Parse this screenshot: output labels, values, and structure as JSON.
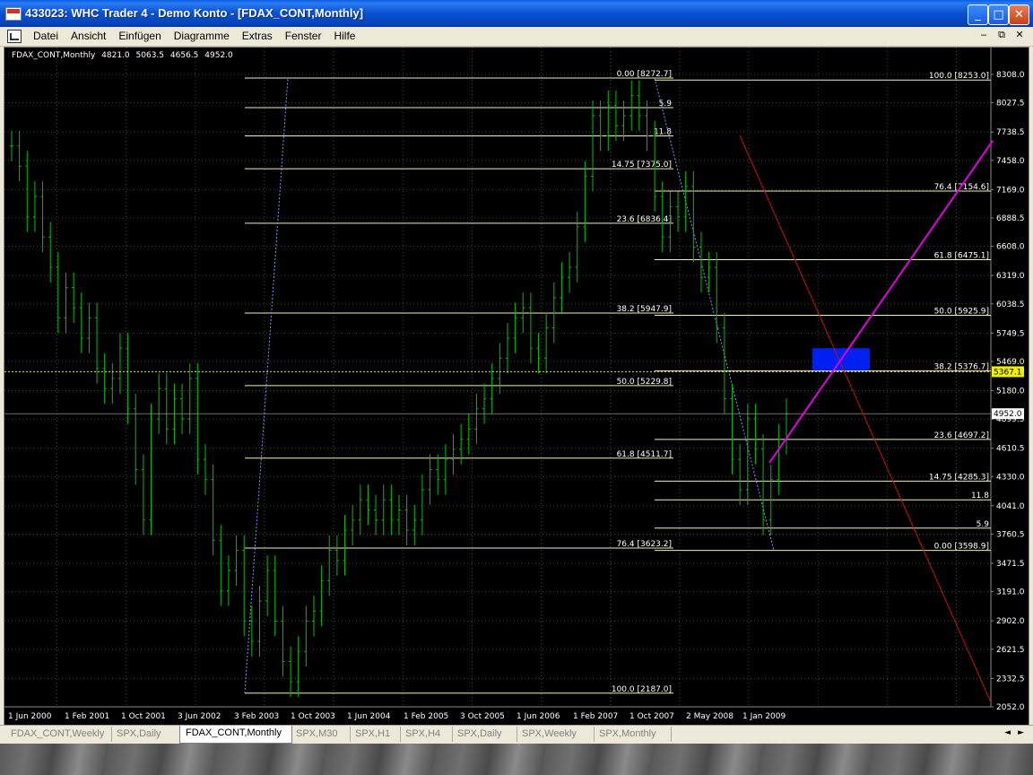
{
  "window": {
    "title": "433023: WHC Trader 4 - Demo Konto - [FDAX_CONT,Monthly]",
    "minimize_label": "_",
    "maximize_label": "□",
    "close_label": "✕"
  },
  "menu": {
    "items": [
      "Datei",
      "Ansicht",
      "Einfügen",
      "Diagramme",
      "Extras",
      "Fenster",
      "Hilfe"
    ],
    "mdi_minimize": "–",
    "mdi_restore": "⧉",
    "mdi_close": "✕"
  },
  "chart": {
    "symbol_period": "FDAX_CONT,Monthly",
    "ohlc": [
      "4821.0",
      "5063.5",
      "4656.5",
      "4952.0"
    ],
    "current_price_label": "4952.0",
    "yellow_level_label": "5367.1"
  },
  "chart_data": {
    "type": "bar",
    "y_axis_labels": [
      "8308.0",
      "8027.5",
      "7738.5",
      "7458.0",
      "7169.0",
      "6888.5",
      "6608.0",
      "6319.0",
      "6038.5",
      "5749.5",
      "5469.0",
      "5180.0",
      "4899.5",
      "4610.5",
      "4330.0",
      "4041.0",
      "3760.5",
      "3471.5",
      "3191.0",
      "2902.0",
      "2621.5",
      "2332.5",
      "2052.0"
    ],
    "x_axis_labels": [
      "1 Jun 2000",
      "1 Feb 2001",
      "1 Oct 2001",
      "3 Jun 2002",
      "3 Feb 2003",
      "1 Oct 2003",
      "1 Jun 2004",
      "1 Feb 2005",
      "3 Oct 2005",
      "1 Jun 2006",
      "1 Feb 2007",
      "1 Oct 2007",
      "2 May 2008",
      "1 Jan 2009"
    ],
    "ylim": [
      2052.0,
      8308.0
    ],
    "fib_set_1": [
      {
        "level": "0.00",
        "value": "8272.7"
      },
      {
        "level": "5.9",
        "value": ""
      },
      {
        "level": "11.8",
        "value": ""
      },
      {
        "level": "14.75",
        "value": "7375.0"
      },
      {
        "level": "23.6",
        "value": "6836.4"
      },
      {
        "level": "38.2",
        "value": "5947.9"
      },
      {
        "level": "50.0",
        "value": "5229.8"
      },
      {
        "level": "61.8",
        "value": "4511.7"
      },
      {
        "level": "76.4",
        "value": "3623.2"
      },
      {
        "level": "100.0",
        "value": "2187.0"
      }
    ],
    "fib_set_2": [
      {
        "level": "100.0",
        "value": "8253.0"
      },
      {
        "level": "76.4",
        "value": "7154.6"
      },
      {
        "level": "61.8",
        "value": "6475.1"
      },
      {
        "level": "50.0",
        "value": "5925.9"
      },
      {
        "level": "38.2",
        "value": "5376.7"
      },
      {
        "level": "23.6",
        "value": "4697.2"
      },
      {
        "level": "14.75",
        "value": "4285.3"
      },
      {
        "level": "11.8",
        "value": ""
      },
      {
        "level": "5.9",
        "value": ""
      },
      {
        "level": "0.00",
        "value": "3598.9"
      }
    ],
    "price_path": [
      7600,
      7400,
      6900,
      7100,
      6700,
      6400,
      5900,
      6200,
      6000,
      5700,
      5900,
      5400,
      5200,
      5300,
      5600,
      5000,
      4400,
      3900,
      4900,
      5200,
      4800,
      5100,
      4900,
      5300,
      4500,
      4300,
      3700,
      3200,
      3400,
      3600,
      2900,
      2700,
      3100,
      3400,
      2900,
      2500,
      2300,
      2600,
      2900,
      3000,
      3300,
      3600,
      3500,
      3800,
      3900,
      4100,
      4000,
      3900,
      4100,
      3900,
      4000,
      3800,
      3900,
      4200,
      4400,
      4300,
      4500,
      4600,
      4700,
      4800,
      5000,
      5100,
      5300,
      5500,
      5700,
      5900,
      6000,
      5600,
      5500,
      5800,
      6100,
      6300,
      6400,
      6800,
      7300,
      7900,
      7700,
      8000,
      7800,
      7900,
      8100,
      7900,
      7700,
      7100,
      6700,
      7000,
      6900,
      7200,
      6600,
      6300,
      6400,
      5800,
      5100,
      4500,
      4200,
      4900,
      4600,
      3900,
      4300,
      4700,
      4952
    ],
    "bar_color": "#00C000"
  },
  "colors": {
    "chart_bg": "#000000",
    "fib_line": "#F0F0B0",
    "red_line": "#C81010",
    "magenta_line": "#E000E0",
    "blue_box": "#0020F0",
    "bid_line": "#F0F000"
  },
  "tabs": [
    {
      "label": "FDAX_CONT,Weekly",
      "active": false
    },
    {
      "label": "SPX,Daily",
      "active": false
    },
    {
      "label": "FDAX_CONT,Monthly",
      "active": true
    },
    {
      "label": "SPX,M30",
      "active": false
    },
    {
      "label": "SPX,H1",
      "active": false
    },
    {
      "label": "SPX,H4",
      "active": false
    },
    {
      "label": "SPX,Daily",
      "active": false
    },
    {
      "label": "SPX,Weekly",
      "active": false
    },
    {
      "label": "SPX,Monthly",
      "active": false
    }
  ],
  "tab_scroll": {
    "left": "◄",
    "right": "►"
  }
}
